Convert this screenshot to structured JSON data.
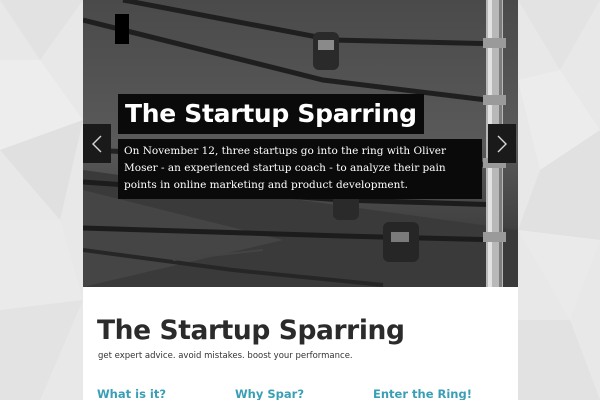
{
  "hero": {
    "slide_title": "The Startup Sparring",
    "slide_text": "On November 12, three startups go into the ring with Oliver Moser - an experienced startup coach - to analyze their pain points in online marketing and product development.",
    "prev_icon": "chevron-left-icon",
    "next_icon": "chevron-right-icon"
  },
  "site": {
    "title": "The Startup Sparring",
    "tagline": "get expert advice. avoid mistakes. boost your performance."
  },
  "sections": [
    {
      "heading": "What is it?"
    },
    {
      "heading": "Why Spar?"
    },
    {
      "heading": "Enter the Ring!"
    }
  ],
  "colors": {
    "accent": "#3a9fb5",
    "caption_bg": "#0a0a0a",
    "page_bg": "#e9e9e9"
  }
}
